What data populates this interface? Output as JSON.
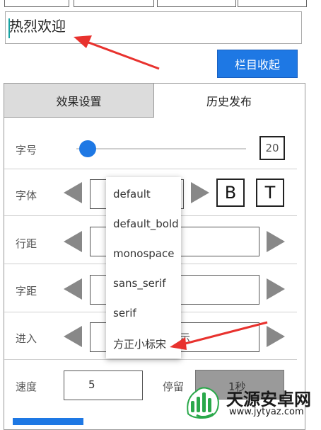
{
  "message_input": {
    "value": "热烈欢迎"
  },
  "collapse_button": {
    "label": "栏目收起"
  },
  "tabs": [
    {
      "label": "效果设置",
      "active": true
    },
    {
      "label": "历史发布",
      "active": false
    }
  ],
  "settings": {
    "font_size": {
      "label": "字号",
      "value": "20"
    },
    "font": {
      "label": "字体",
      "bold_label": "B",
      "text_label": "T"
    },
    "line_spacing": {
      "label": "行距"
    },
    "char_spacing": {
      "label": "字距"
    },
    "enter": {
      "label": "进入",
      "value_partial": "示"
    },
    "speed": {
      "label": "速度",
      "value": "5"
    },
    "stay": {
      "label": "停留",
      "value": "1秒"
    }
  },
  "font_dropdown": {
    "options": [
      "default",
      "default_bold",
      "monospace",
      "sans_serif",
      "serif",
      "方正小标宋"
    ]
  },
  "watermark": {
    "title": "天源安卓网",
    "url": "www.jytyaz.com"
  },
  "colors": {
    "accent": "#1e78e4",
    "annotation": "#e8322e"
  }
}
